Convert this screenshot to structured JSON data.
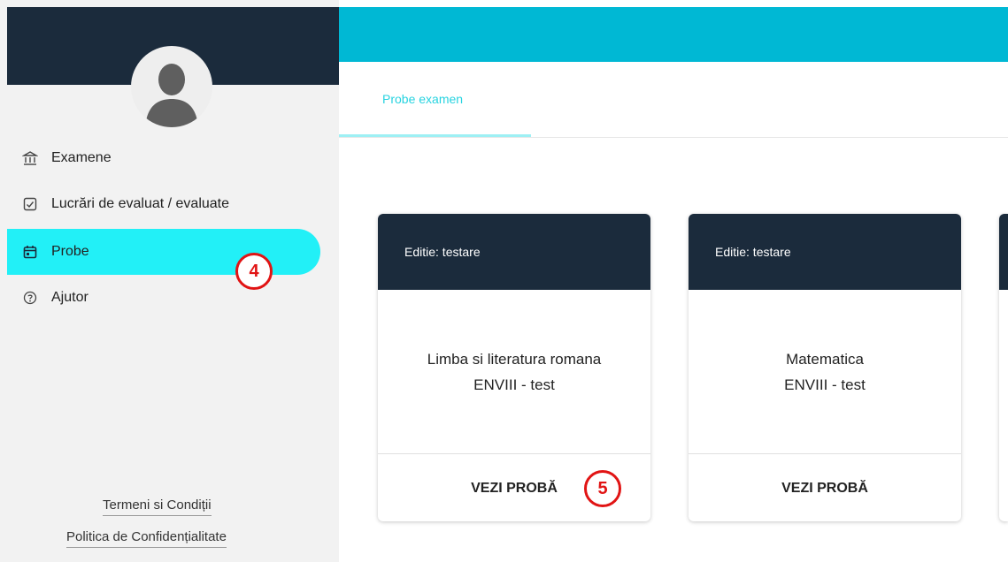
{
  "sidebar": {
    "items": [
      {
        "label": "Examene",
        "icon": "institution-icon"
      },
      {
        "label": "Lucrări de evaluat / evaluate",
        "icon": "checkbox-icon"
      },
      {
        "label": "Probe",
        "icon": "calendar-icon"
      },
      {
        "label": "Ajutor",
        "icon": "help-circle-icon"
      }
    ],
    "active_item": "Probe",
    "footer": {
      "terms": "Termeni si Condiții",
      "privacy": "Politica de Confidențialitate"
    }
  },
  "main": {
    "tabs": [
      {
        "label": "Probe examen"
      }
    ],
    "cards": [
      {
        "header": "Editie: testare",
        "title": "Limba si literatura romana",
        "subtitle": "ENVIII - test",
        "action": "VEZI PROBĂ"
      },
      {
        "header": "Editie: testare",
        "title": "Matematica",
        "subtitle": "ENVIII - test",
        "action": "VEZI PROBĂ"
      }
    ]
  },
  "annotations": {
    "badge_4": "4",
    "badge_5": "5"
  },
  "colors": {
    "sidebar_dark": "#1b2b3c",
    "topbar": "#00b8d4",
    "active_nav": "#22f0f7",
    "tab_text": "#27d3e0",
    "annotation": "#e11414"
  }
}
